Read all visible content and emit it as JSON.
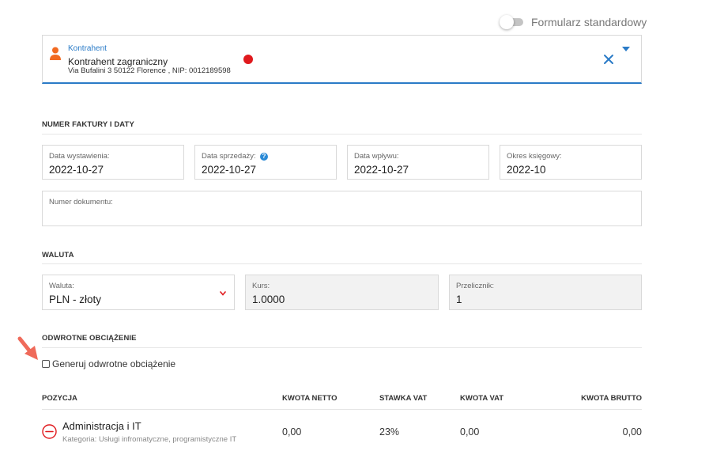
{
  "form_toggle": {
    "label": "Formularz standardowy",
    "enabled": false
  },
  "contractor": {
    "label": "Kontrahent",
    "name": "Kontrahent zagraniczny",
    "address": "Via Bufalini 3 50122 Florence , NIP: 0012189598",
    "status_color": "#e0191d"
  },
  "invoice_section": {
    "title": "NUMER FAKTURY I DATY",
    "issue_date": {
      "label": "Data wystawienia:",
      "value": "2022-10-27"
    },
    "sale_date": {
      "label": "Data sprzedaży:",
      "value": "2022-10-27",
      "help": "?"
    },
    "receipt_date": {
      "label": "Data wpływu:",
      "value": "2022-10-27"
    },
    "accounting_period": {
      "label": "Okres księgowy:",
      "value": "2022-10"
    },
    "document_number": {
      "label": "Numer dokumentu:",
      "value": ""
    }
  },
  "currency_section": {
    "title": "WALUTA",
    "currency": {
      "label": "Waluta:",
      "value": "PLN - złoty"
    },
    "rate": {
      "label": "Kurs:",
      "value": "1.0000"
    },
    "multiplier": {
      "label": "Przelicznik:",
      "value": "1"
    }
  },
  "reverse_charge_section": {
    "title": "ODWROTNE OBCIĄŻENIE",
    "checkbox_label": "Generuj odwrotne obciążenie",
    "checked": false
  },
  "positions_table": {
    "headers": {
      "position": "POZYCJA",
      "net": "KWOTA NETTO",
      "vat_rate": "STAWKA VAT",
      "vat": "KWOTA VAT",
      "gross": "KWOTA BRUTTO"
    },
    "rows": [
      {
        "name": "Administracja i IT",
        "category": "Kategoria: Usługi infromatyczne, programistyczne IT",
        "net": "0,00",
        "vat_rate": "23%",
        "vat": "0,00",
        "gross": "0,00"
      }
    ]
  },
  "colors": {
    "accent": "#2a7bc7",
    "orange": "#f26a21",
    "danger": "#e0191d",
    "annotation_arrow": "#ef6a5a"
  }
}
